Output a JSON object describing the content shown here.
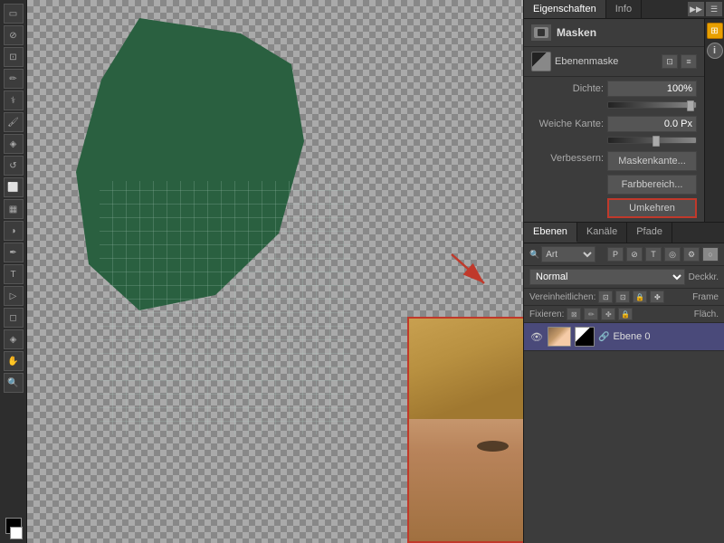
{
  "header": {
    "tabs": [
      {
        "label": "Eigenschaften",
        "active": true
      },
      {
        "label": "Info",
        "active": false
      }
    ]
  },
  "properties_panel": {
    "title": "Masken",
    "ebenenmaske_label": "Ebenenmaske",
    "dichte_label": "Dichte:",
    "dichte_value": "100%",
    "weiche_kante_label": "Weiche Kante:",
    "weiche_kante_value": "0.0 Px",
    "verbessern_label": "Verbessern:",
    "btn_maskenkante": "Maskenkante...",
    "btn_farbbereich": "Farbbereich...",
    "btn_umkehren": "Umkehren"
  },
  "layers_panel": {
    "tabs": [
      {
        "label": "Ebenen",
        "active": true
      },
      {
        "label": "Kanäle",
        "active": false
      },
      {
        "label": "Pfade",
        "active": false
      }
    ],
    "filter_label": "Art",
    "blending_mode": "Normal",
    "deckkraft_label": "Deckkr.",
    "vereinheitlichen_label": "Vereinheitlichen:",
    "fixieren_label": "Fixieren:",
    "flaeche_label": "Fläch.",
    "layer": {
      "name": "Ebene 0"
    }
  },
  "icons": {
    "eye": "👁",
    "link": "🔗",
    "info": "i",
    "search": "🔍",
    "gear": "⚙",
    "close": "✕",
    "arrow_right": "▶",
    "lock": "🔒",
    "grid": "⊞"
  }
}
